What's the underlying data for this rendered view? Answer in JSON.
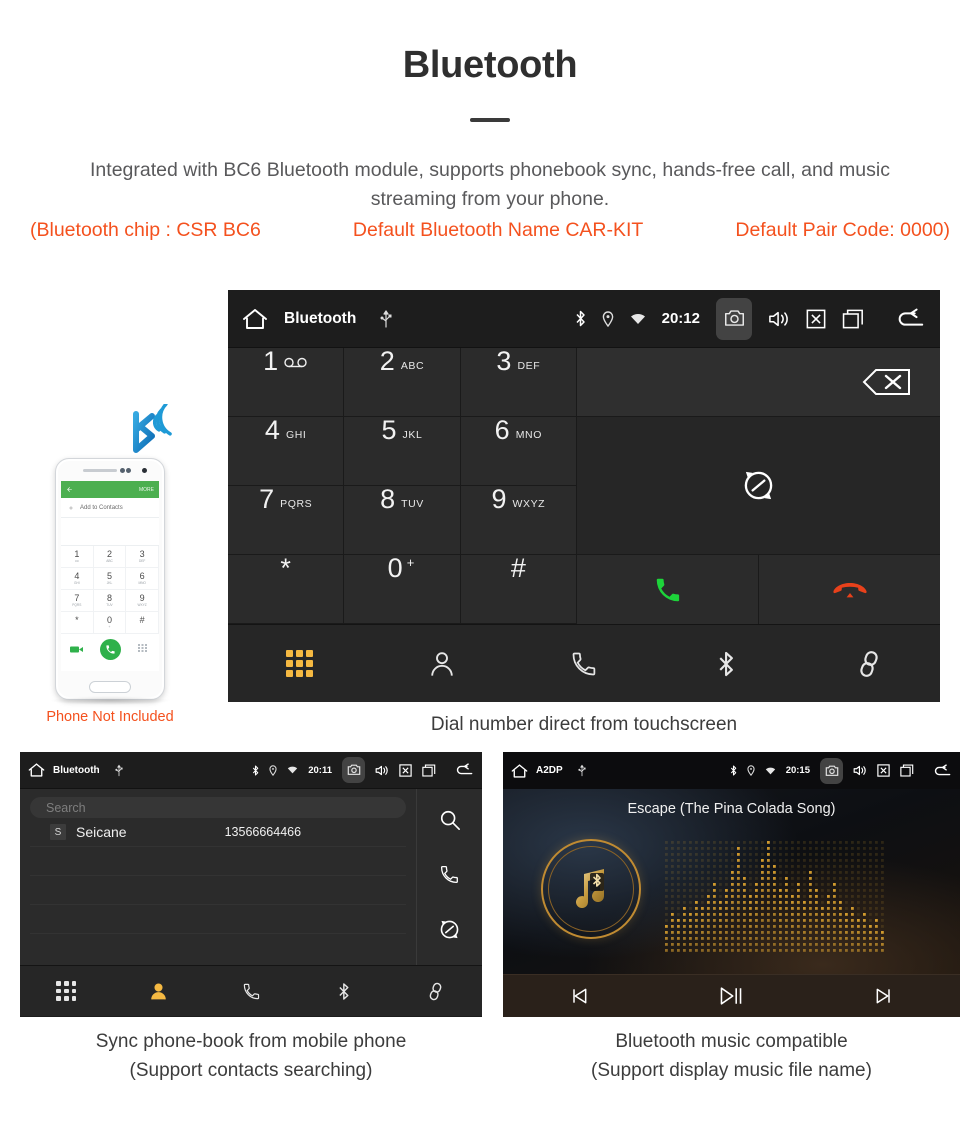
{
  "hero": {
    "title": "Bluetooth",
    "description": "Integrated with BC6 Bluetooth module, supports phonebook sync, hands-free call, and music streaming from your phone.",
    "spec_chip": "(Bluetooth chip : CSR BC6",
    "spec_name": "Default Bluetooth Name CAR-KIT",
    "spec_pair": "Default Pair Code: 0000)",
    "accent_color": "#f4511e",
    "text_color": "#59595b"
  },
  "dialer": {
    "statusbar": {
      "home_icon": "home-icon",
      "title": "Bluetooth",
      "usb_icon": "usb-icon",
      "bluetooth_icon": "bluetooth-icon",
      "location_icon": "location-icon",
      "wifi_icon": "wifi-icon",
      "clock": "20:12",
      "camera_icon": "camera-icon",
      "volume_icon": "volume-icon",
      "close_icon": "close-box-icon",
      "recents_icon": "recents-icon",
      "back_icon": "back-icon"
    },
    "keys": [
      {
        "num": "1",
        "sub": "",
        "voicemail": true
      },
      {
        "num": "2",
        "sub": "ABC"
      },
      {
        "num": "3",
        "sub": "DEF"
      },
      {
        "num": "4",
        "sub": "GHI"
      },
      {
        "num": "5",
        "sub": "JKL"
      },
      {
        "num": "6",
        "sub": "MNO"
      },
      {
        "num": "7",
        "sub": "PQRS"
      },
      {
        "num": "8",
        "sub": "TUV"
      },
      {
        "num": "9",
        "sub": "WXYZ"
      },
      {
        "num": "*",
        "sub": ""
      },
      {
        "num": "0",
        "sub": "",
        "plus": "+"
      },
      {
        "num": "#",
        "sub": ""
      }
    ],
    "backspace_icon": "backspace-icon",
    "sync_icon": "sync-icon",
    "call_icon": "call-icon",
    "hangup_icon": "hangup-icon",
    "call_color": "#1dd33a",
    "hangup_color": "#e8411b",
    "nav": [
      {
        "name": "keypad",
        "icon": "keypad-icon",
        "active": true
      },
      {
        "name": "contacts",
        "icon": "person-icon",
        "active": false
      },
      {
        "name": "call-log",
        "icon": "phone-icon",
        "active": false
      },
      {
        "name": "bluetooth",
        "icon": "bluetooth-icon",
        "active": false
      },
      {
        "name": "link",
        "icon": "link-icon",
        "active": false
      }
    ],
    "active_color": "#f5b942",
    "caption": "Dial number direct from touchscreen"
  },
  "phonebook": {
    "statusbar": {
      "title": "Bluetooth",
      "clock": "20:11"
    },
    "search_placeholder": "Search",
    "contacts": [
      {
        "initial": "S",
        "name": "Seicane",
        "number": "13566664466"
      }
    ],
    "side_actions": [
      {
        "name": "search",
        "icon": "search-icon"
      },
      {
        "name": "call",
        "icon": "phone-icon"
      },
      {
        "name": "sync",
        "icon": "sync-icon"
      }
    ],
    "nav": [
      {
        "name": "keypad",
        "icon": "keypad-icon",
        "active": false
      },
      {
        "name": "contacts",
        "icon": "person-icon",
        "active": true
      },
      {
        "name": "call-log",
        "icon": "phone-icon",
        "active": false
      },
      {
        "name": "bluetooth",
        "icon": "bluetooth-icon",
        "active": false
      },
      {
        "name": "link",
        "icon": "link-icon",
        "active": false
      }
    ],
    "caption_line1": "Sync phone-book from mobile phone",
    "caption_line2": "(Support contacts searching)"
  },
  "music": {
    "statusbar": {
      "title": "A2DP",
      "clock": "20:15"
    },
    "song_title": "Escape (The Pina Colada Song)",
    "album_art_icon": "music-note-bluetooth-icon",
    "visualizer_color": "#d09a2e",
    "controls": [
      {
        "name": "previous",
        "icon": "skip-previous-icon"
      },
      {
        "name": "play-pause",
        "icon": "play-pause-icon"
      },
      {
        "name": "next",
        "icon": "skip-next-icon"
      }
    ],
    "caption_line1": "Bluetooth music compatible",
    "caption_line2": "(Support display music file name)"
  },
  "phone_mockup": {
    "appbar_back_icon": "arrow-back-icon",
    "appbar_more": "MORE",
    "add_contacts": "Add to Contacts",
    "keys": [
      {
        "num": "1",
        "sub": "oo"
      },
      {
        "num": "2",
        "sub": "ABC"
      },
      {
        "num": "3",
        "sub": "DEF"
      },
      {
        "num": "4",
        "sub": "GHI"
      },
      {
        "num": "5",
        "sub": "JKL"
      },
      {
        "num": "6",
        "sub": "MNO"
      },
      {
        "num": "7",
        "sub": "PQRS"
      },
      {
        "num": "8",
        "sub": "TUV"
      },
      {
        "num": "9",
        "sub": "WXYZ"
      },
      {
        "num": "*",
        "sub": ""
      },
      {
        "num": "0",
        "sub": "+"
      },
      {
        "num": "#",
        "sub": ""
      }
    ],
    "bluetooth_badge_icon": "bluetooth-signal-icon",
    "not_included_note": "Phone Not Included"
  }
}
